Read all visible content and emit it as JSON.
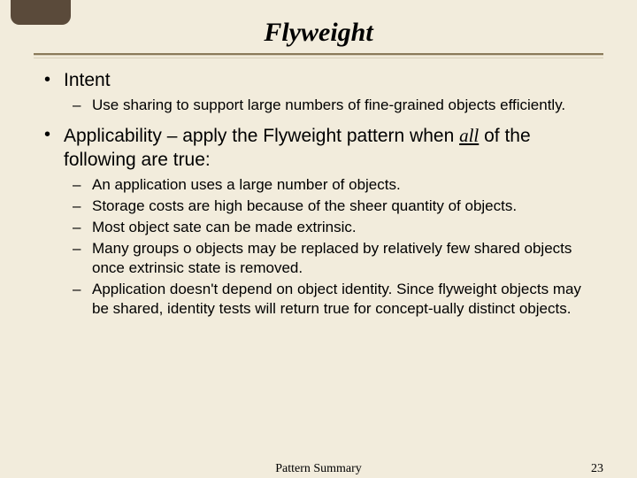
{
  "title": "Flyweight",
  "bullets": {
    "b1": {
      "label": "Intent",
      "sub": {
        "s0": "Use sharing to support large numbers of fine-grained objects efficiently."
      }
    },
    "b2": {
      "label_pre": "Applicability – apply the Flyweight pattern when ",
      "label_emph": "all",
      "label_post": " of the following are true:",
      "sub": {
        "s0": "An application uses a large number of objects.",
        "s1": "Storage costs are high because of the sheer quantity of objects.",
        "s2": "Most object sate can be made extrinsic.",
        "s3": "Many groups o objects may be replaced by relatively few shared objects once extrinsic state is removed.",
        "s4": "Application doesn't depend on object identity.  Since flyweight objects may be shared, identity tests will return true for concept-ually distinct objects."
      }
    }
  },
  "footer": {
    "center": "Pattern Summary",
    "page": "23"
  }
}
